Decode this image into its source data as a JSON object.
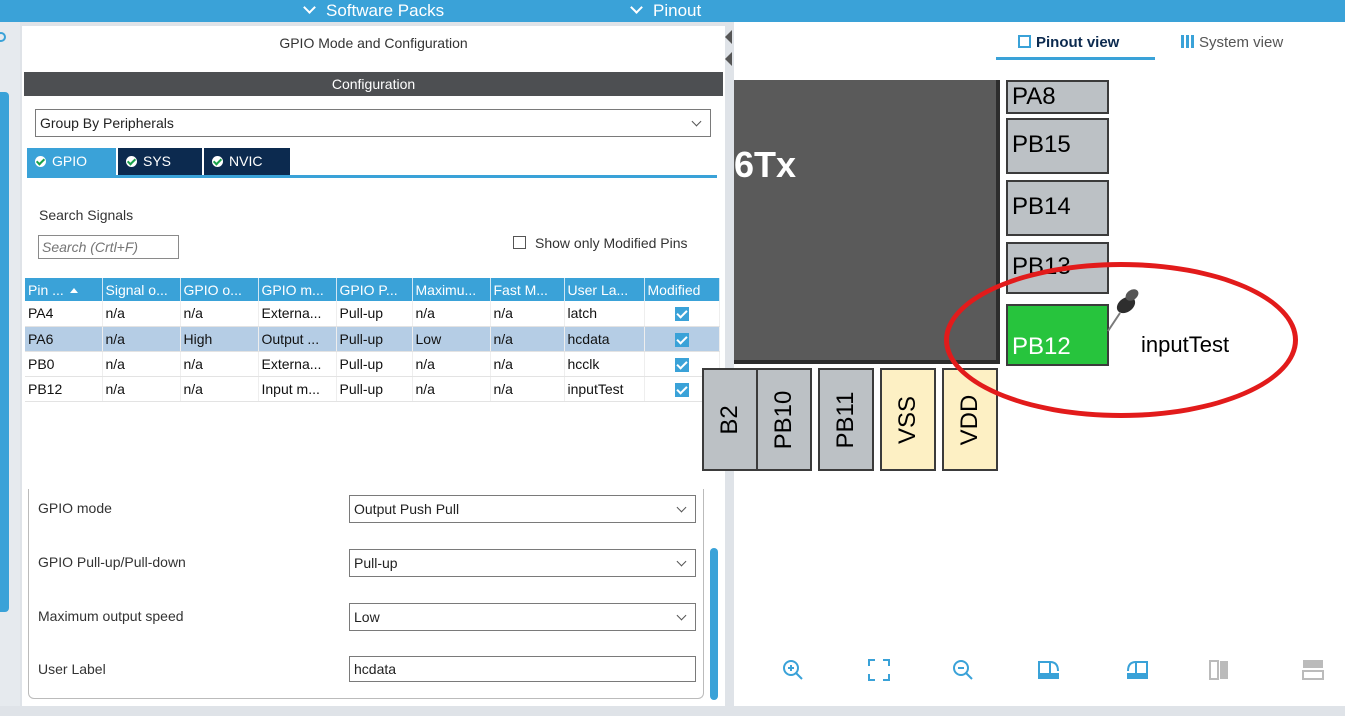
{
  "topbar": {
    "software_packs": "Software Packs",
    "pinout": "Pinout"
  },
  "panel": {
    "title": "GPIO Mode and Configuration",
    "config_header": "Configuration",
    "group_by": "Group By Peripherals",
    "tabs": [
      {
        "label": "GPIO"
      },
      {
        "label": "SYS"
      },
      {
        "label": "NVIC"
      }
    ],
    "search_label": "Search Signals",
    "search_placeholder": "Search (Crtl+F)",
    "show_modified": "Show only Modified Pins"
  },
  "table": {
    "headers": [
      "Pin ...",
      "Signal o...",
      "GPIO o...",
      "GPIO m...",
      "GPIO P...",
      "Maximu...",
      "Fast M...",
      "User La...",
      "Modified"
    ],
    "rows": [
      {
        "pin": "PA4",
        "signal": "n/a",
        "gpio_out": "n/a",
        "mode": "Externa...",
        "pull": "Pull-up",
        "max": "n/a",
        "fast": "n/a",
        "label": "latch",
        "modified": true
      },
      {
        "pin": "PA6",
        "signal": "n/a",
        "gpio_out": "High",
        "mode": "Output ...",
        "pull": "Pull-up",
        "max": "Low",
        "fast": "n/a",
        "label": "hcdata",
        "modified": true
      },
      {
        "pin": "PB0",
        "signal": "n/a",
        "gpio_out": "n/a",
        "mode": "Externa...",
        "pull": "Pull-up",
        "max": "n/a",
        "fast": "n/a",
        "label": "hcclk",
        "modified": true
      },
      {
        "pin": "PB12",
        "signal": "n/a",
        "gpio_out": "n/a",
        "mode": "Input m...",
        "pull": "Pull-up",
        "max": "n/a",
        "fast": "n/a",
        "label": "inputTest",
        "modified": true
      }
    ]
  },
  "details": {
    "gpio_mode": {
      "label": "GPIO mode",
      "value": "Output Push Pull"
    },
    "pull": {
      "label": "GPIO Pull-up/Pull-down",
      "value": "Pull-up"
    },
    "speed": {
      "label": "Maximum output speed",
      "value": "Low"
    },
    "user_label": {
      "label": "User Label",
      "value": "hcdata"
    }
  },
  "right": {
    "pinout_view": "Pinout view",
    "system_view": "System view",
    "chip_text": "6Tx",
    "pins_right": [
      "PA8",
      "PB15",
      "PB14",
      "PB13",
      "PB12"
    ],
    "pins_bottom": [
      "B2",
      "PB10",
      "PB11",
      "VSS",
      "VDD"
    ],
    "pb12_user_label": "inputTest"
  },
  "colors": {
    "accent": "#3aa2d8",
    "dark_tab": "#0c2a4f",
    "pin_green": "#27c43d",
    "pin_gray": "#bcc1c5",
    "pin_power": "#fdf0c4",
    "annotation_red": "#e21b1b"
  },
  "icons": {
    "toolbar": [
      "zoom-in-icon",
      "fit-screen-icon",
      "zoom-out-icon",
      "rotate-right-icon",
      "rotate-left-icon",
      "flip-vertical-icon",
      "flip-horizontal-icon"
    ]
  }
}
